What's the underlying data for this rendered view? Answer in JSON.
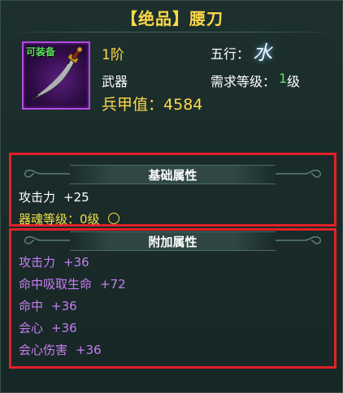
{
  "title": "【绝品】腰刀",
  "colors": {
    "title": "#ffd84a",
    "tier": "#ffd84a",
    "score": "#ffd84a",
    "type": "#ffffff",
    "label": "#ffffff",
    "required_level": "#5ce05c",
    "element": "#e8f4ff",
    "extra_stat": "#c77df2",
    "soul": "#f2e04a",
    "quality_border": "#b24be0",
    "highlight_box": "#e3202a"
  },
  "icon": {
    "name": "saber-icon",
    "tag": "可装备"
  },
  "info": {
    "tier": "1阶",
    "type": "武器",
    "score_label": "兵甲值：",
    "score": "4584",
    "element_label": "五行：",
    "element": "水",
    "req_label": "需求等级：",
    "req_level": "1",
    "req_suffix": "级"
  },
  "base_section": {
    "header": "基础属性",
    "stats": [
      {
        "name": "攻击力",
        "value": "+25"
      }
    ],
    "soul": "器魂等级：0级"
  },
  "extra_section": {
    "header": "附加属性",
    "stats": [
      {
        "name": "攻击力",
        "value": "+36"
      },
      {
        "name": "命中吸取生命",
        "value": "+72"
      },
      {
        "name": "命中",
        "value": "+36"
      },
      {
        "name": "会心",
        "value": "+36"
      },
      {
        "name": "会心伤害",
        "value": "+36"
      }
    ]
  }
}
